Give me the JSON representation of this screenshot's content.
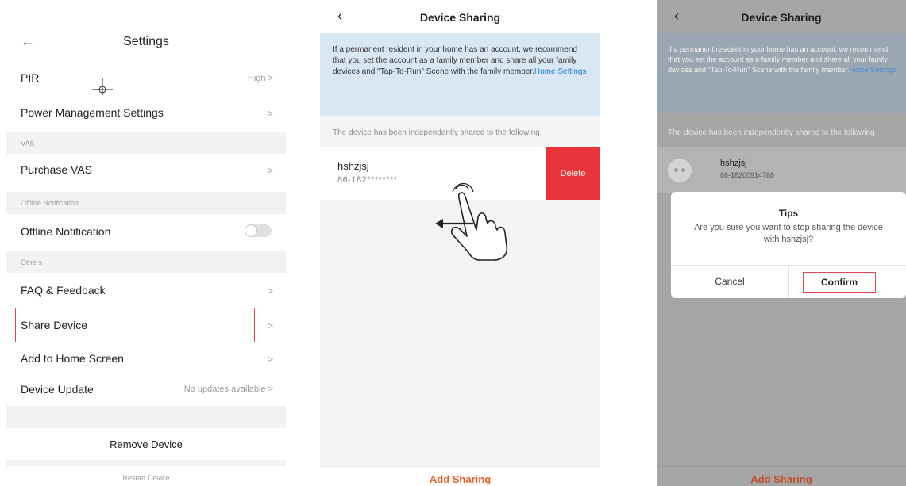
{
  "settings": {
    "title": "Settings",
    "pir": {
      "label": "PIR",
      "value": "High >"
    },
    "power_management": {
      "label": "Power Management Settings",
      "chevron": ">"
    },
    "section_vas": "VAS",
    "purchase_vas": {
      "label": "Purchase VAS",
      "chevron": ">"
    },
    "section_offline": "Offline Notification",
    "offline_notification": {
      "label": "Offline Notification",
      "toggle_on": false
    },
    "section_others": "Others",
    "faq": {
      "label": "FAQ & Feedback",
      "chevron": ">"
    },
    "share_device": {
      "label": "Share Device",
      "chevron": ">"
    },
    "add_home": {
      "label": "Add to Home Screen",
      "chevron": ">"
    },
    "device_update": {
      "label": "Device Update",
      "value": "No updates available >"
    },
    "remove_device": "Remove Device",
    "restart_device": "Restart Device"
  },
  "sharing": {
    "title": "Device Sharing",
    "info_text": "If a permanent resident in your home has an account, we recommend that you set the account as a family member and share all your family devices and \"Tap-To-Run\" Scene with the family member.",
    "info_link": "Home Settings",
    "shared_label": "The device has been independently shared to the following",
    "user_name": "hshzjsj",
    "user_phone_masked": "86-182********",
    "delete_label": "Delete",
    "add_sharing": "Add Sharing"
  },
  "confirm_screen": {
    "title": "Device Sharing",
    "info_text": "If a permanent resident in your home has an account, we recommend that you set the account as a family member and share all your family devices and \"Tap-To-Run\" Scene with the family member.",
    "info_link": "Home Settings",
    "shared_label": "The device has been independently shared to the following",
    "user_name": "hshzjsj",
    "user_phone": "86-18200914788",
    "dialog_title": "Tips",
    "dialog_message": "Are you sure you want to stop sharing the device with hshzjsj?",
    "cancel": "Cancel",
    "confirm": "Confirm",
    "add_sharing": "Add Sharing"
  },
  "colors": {
    "highlight": "#e0484d",
    "delete_red": "#e8333a",
    "accent_orange": "#f0602c",
    "link_blue": "#1e7bd8",
    "info_bg": "#d9e7f3"
  }
}
